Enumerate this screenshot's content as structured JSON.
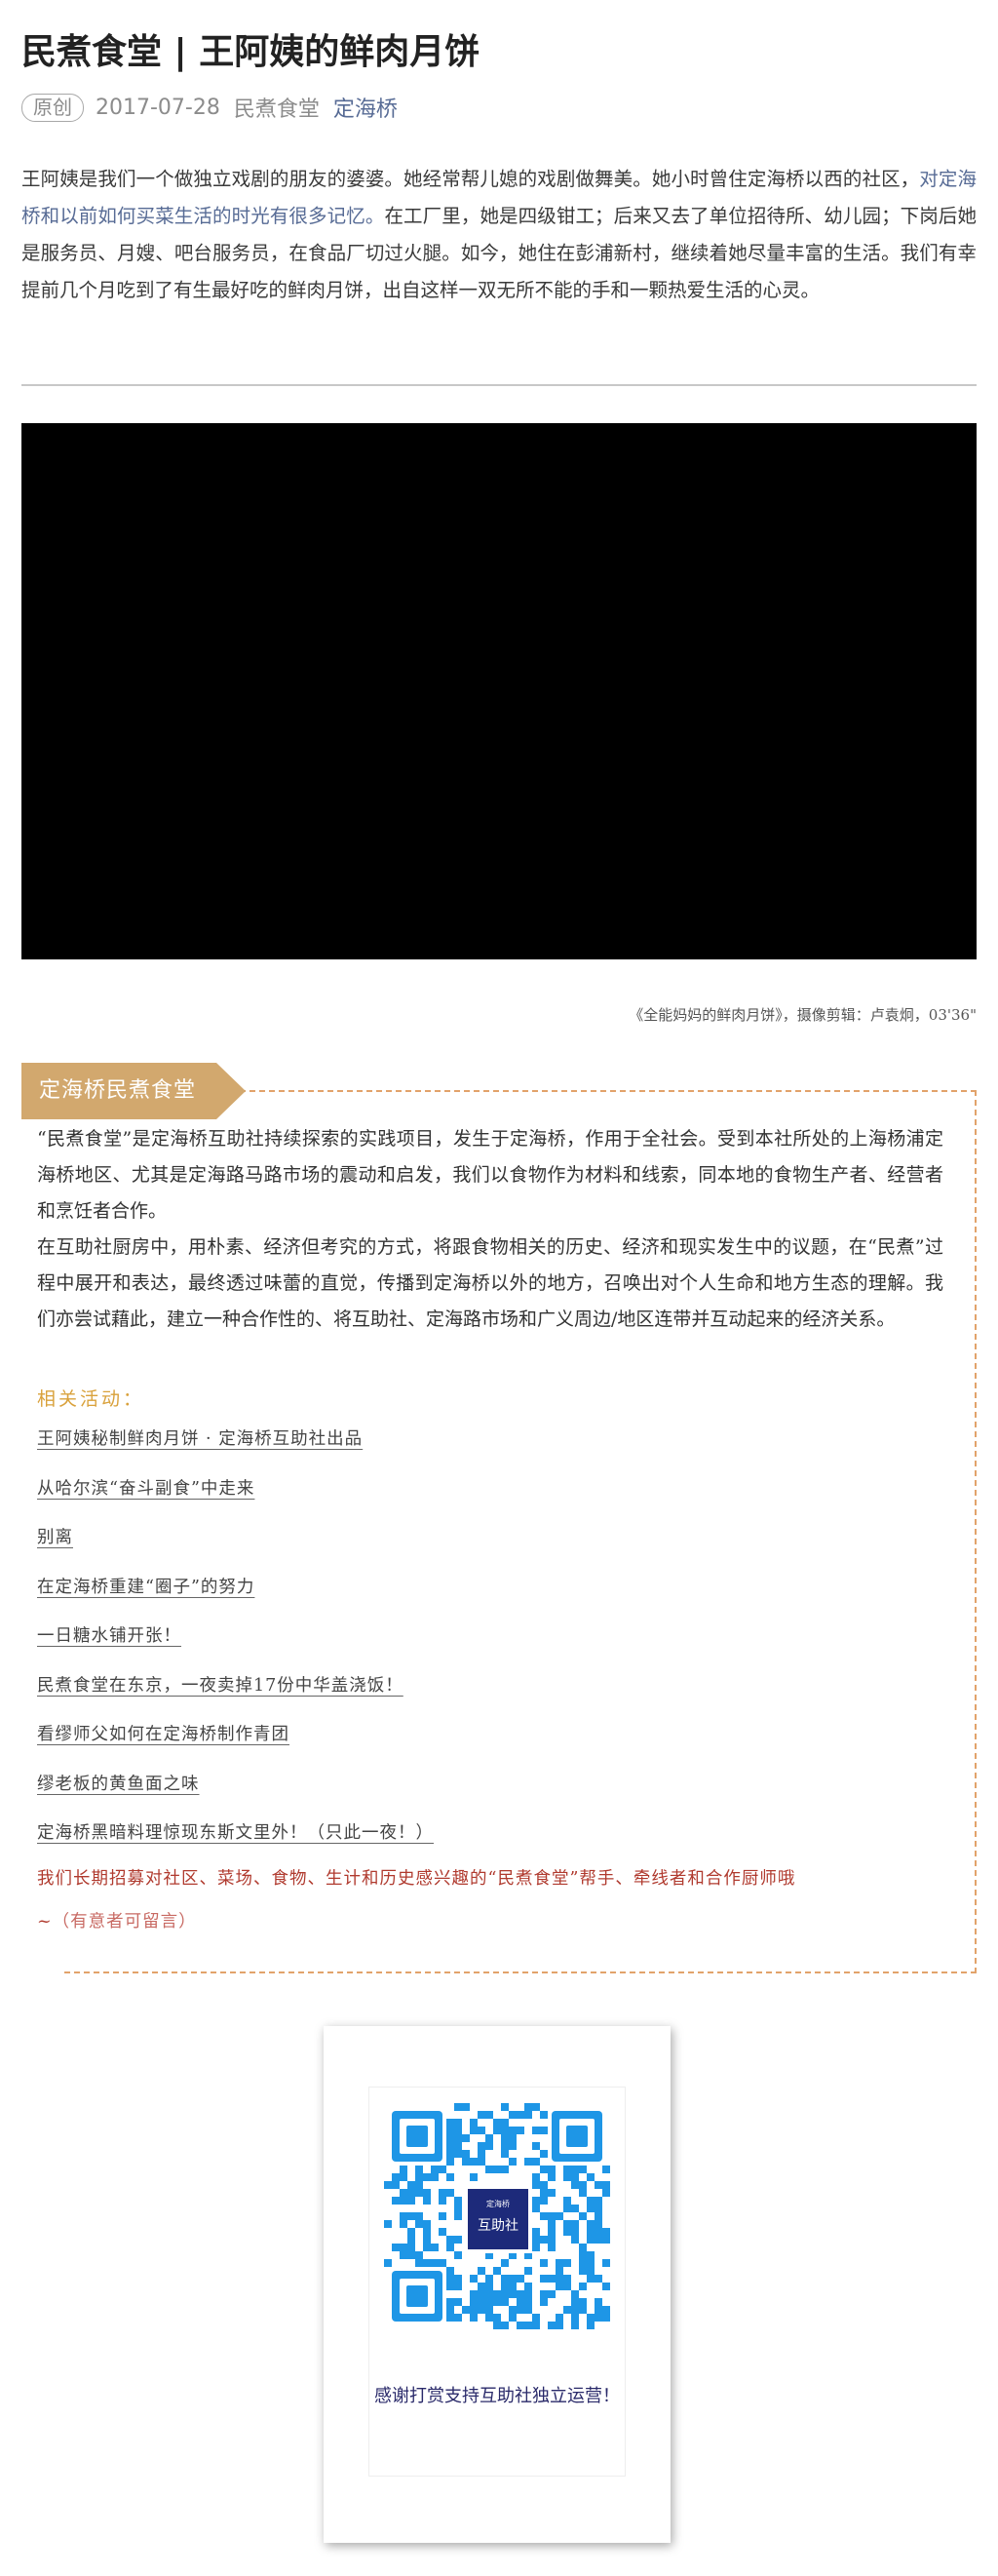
{
  "article": {
    "title": "民煮食堂 | 王阿姨的鲜肉月饼",
    "badge": "原创",
    "date": "2017-07-28",
    "account": "民煮食堂",
    "author_link": "定海桥"
  },
  "intro": {
    "part1": "王阿姨是我们一个做独立戏剧的朋友的婆婆。她经常帮儿媳的戏剧做舞美。她小时曾住定海桥以西的社区，",
    "highlight": "对定海桥和以前如何买菜生活的时光有很多记忆。",
    "part2": "在工厂里，她是四级钳工；后来又去了单位招待所、幼儿园；下岗后她是服务员、月嫂、吧台服务员，在食品厂切过火腿。如今，她住在彭浦新村，继续着她尽量丰富的生活。我们有幸提前几个月吃到了有生最好吃的鲜肉月饼，出自这样一双无所不能的手和一颗热爱生活的心灵。"
  },
  "video": {
    "caption": "《全能妈妈的鲜肉月饼》，摄像剪辑：卢袁炯，03'36\""
  },
  "panel": {
    "ribbon": "定海桥民煮食堂",
    "desc1": "“民煮食堂”是定海桥互助社持续探索的实践项目，发生于定海桥，作用于全社会。受到本社所处的上海杨浦定海桥地区、尤其是定海路马路市场的震动和启发，我们以食物作为材料和线索，同本地的食物生产者、经营者和烹饪者合作。",
    "desc2": "在互助社厨房中，用朴素、经济但考究的方式，将跟食物相关的历史、经济和现实发生中的议题，在“民煮”过程中展开和表达，最终透过味蕾的直觉，传播到定海桥以外的地方，召唤出对个人生命和地方生态的理解。我们亦尝试藉此，建立一种合作性的、将互助社、定海路市场和广义周边/地区连带并互动起来的经济关系。",
    "related_title": "相关活动：",
    "links": [
      "王阿姨秘制鲜肉月饼 · 定海桥互助社出品",
      "从哈尔滨“奋斗副食”中走来",
      "别离",
      "在定海桥重建“圈子”的努力",
      "一日糖水铺开张！",
      "民煮食堂在东京，一夜卖掉17份中华盖浇饭！",
      "看缪师父如何在定海桥制作青团",
      "缪老板的黄鱼面之味",
      "定海桥黑暗料理惊现东斯文里外！（只此一夜！）"
    ],
    "recruit_line1": "我们长期招募对社区、菜场、食物、生计和历史感兴趣的“民煮食堂”帮手、牵线者和合作厨师哦",
    "recruit_line2_a": "~",
    "recruit_line2_b": "（有意者可留言）"
  },
  "qr": {
    "center_small": "定海桥",
    "center_big": "互助社",
    "thanks": "感谢打赏支持互助社独立运营！"
  },
  "colors": {
    "link_blue": "#576b95",
    "ribbon_tan": "#d2a86e",
    "dash_orange": "#e2a36b",
    "related_gold": "#d9a13b",
    "recruit_red": "#b03a2e",
    "qr_blue": "#1e96e6",
    "qr_navy": "#1d2a7a"
  }
}
